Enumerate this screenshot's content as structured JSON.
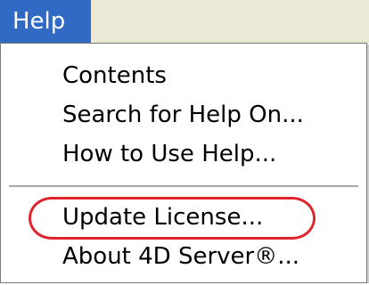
{
  "menubar": {
    "menu_title": "Help"
  },
  "help_menu": {
    "items": [
      {
        "label": "Contents"
      },
      {
        "label": "Search for Help On..."
      },
      {
        "label": "How to Use Help..."
      },
      {
        "label": "Update License..."
      },
      {
        "label": "About 4D Server®..."
      }
    ]
  },
  "colors": {
    "menu_title_bg": "#316ac5",
    "menubar_bg": "#ece9d8",
    "annotation_ellipse": "#e0252f"
  }
}
